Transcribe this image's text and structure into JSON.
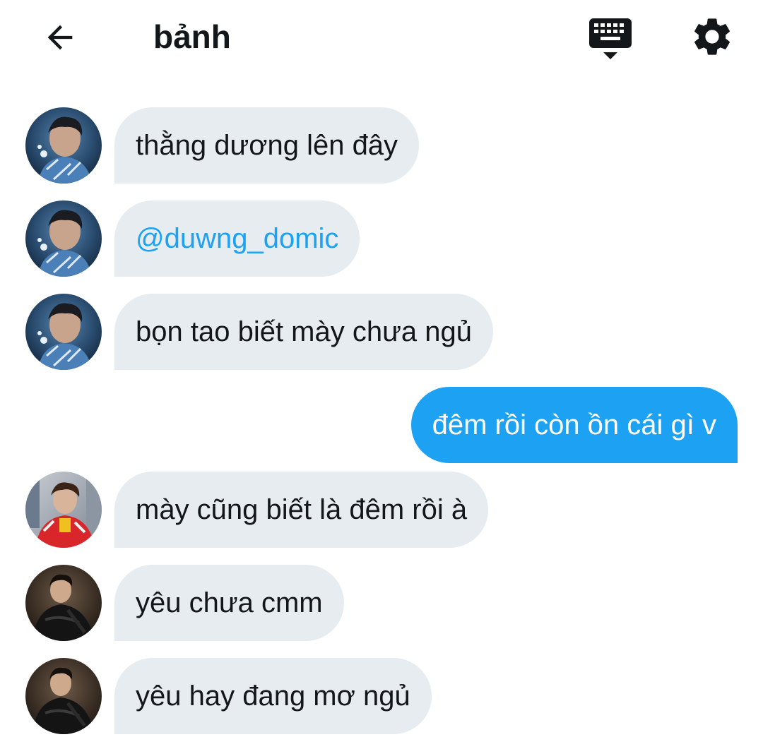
{
  "header": {
    "title": "bảnh",
    "back_icon": "arrow-left-icon",
    "keyboard_icon": "keyboard-hide-icon",
    "settings_icon": "gear-icon"
  },
  "colors": {
    "incoming_bubble": "#e6ecf0",
    "outgoing_bubble": "#1da1f2",
    "mention": "#1da1f2",
    "text": "#14171a"
  },
  "messages": [
    {
      "direction": "incoming",
      "sender_avatar": "avatar-blue-portrait",
      "text": "thằng dương lên đây"
    },
    {
      "direction": "incoming",
      "sender_avatar": "avatar-blue-portrait",
      "text": "@duwng_domic"
    },
    {
      "direction": "incoming",
      "sender_avatar": "avatar-blue-portrait",
      "text": "bọn tao biết mày chưa ngủ"
    },
    {
      "direction": "outgoing",
      "text": "đêm rồi còn ồn cái gì v"
    },
    {
      "direction": "incoming",
      "sender_avatar": "avatar-red-jacket",
      "text": "mày cũng biết là đêm rồi à"
    },
    {
      "direction": "incoming",
      "sender_avatar": "avatar-black-leather",
      "text": "yêu chưa cmm"
    },
    {
      "direction": "incoming",
      "sender_avatar": "avatar-black-leather",
      "text": "yêu hay đang mơ ngủ"
    }
  ]
}
